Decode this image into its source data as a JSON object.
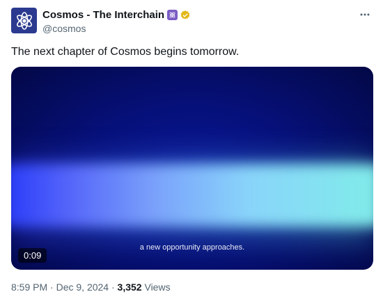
{
  "account": {
    "display_name": "Cosmos - The Interchain",
    "handle": "@cosmos"
  },
  "tweet": {
    "text": "The next chapter of Cosmos begins tomorrow."
  },
  "video": {
    "subtitle": "a new opportunity approaches.",
    "duration": "0:09"
  },
  "meta": {
    "time": "8:59 PM",
    "separator1": "·",
    "date": "Dec 9, 2024",
    "separator2": "·",
    "views_count": "3,352",
    "views_label": "Views"
  },
  "icons": {
    "avatar": "cosmos-atom-logo",
    "affiliate_badge": "atom-icon",
    "verified": "verified-badge-icon",
    "more": "more-options-icon"
  },
  "colors": {
    "avatar_bg": "#2b3a8f",
    "badge_bg": "#7a5cc4",
    "verified_gold": "#e2b719",
    "text_secondary": "#536471"
  }
}
